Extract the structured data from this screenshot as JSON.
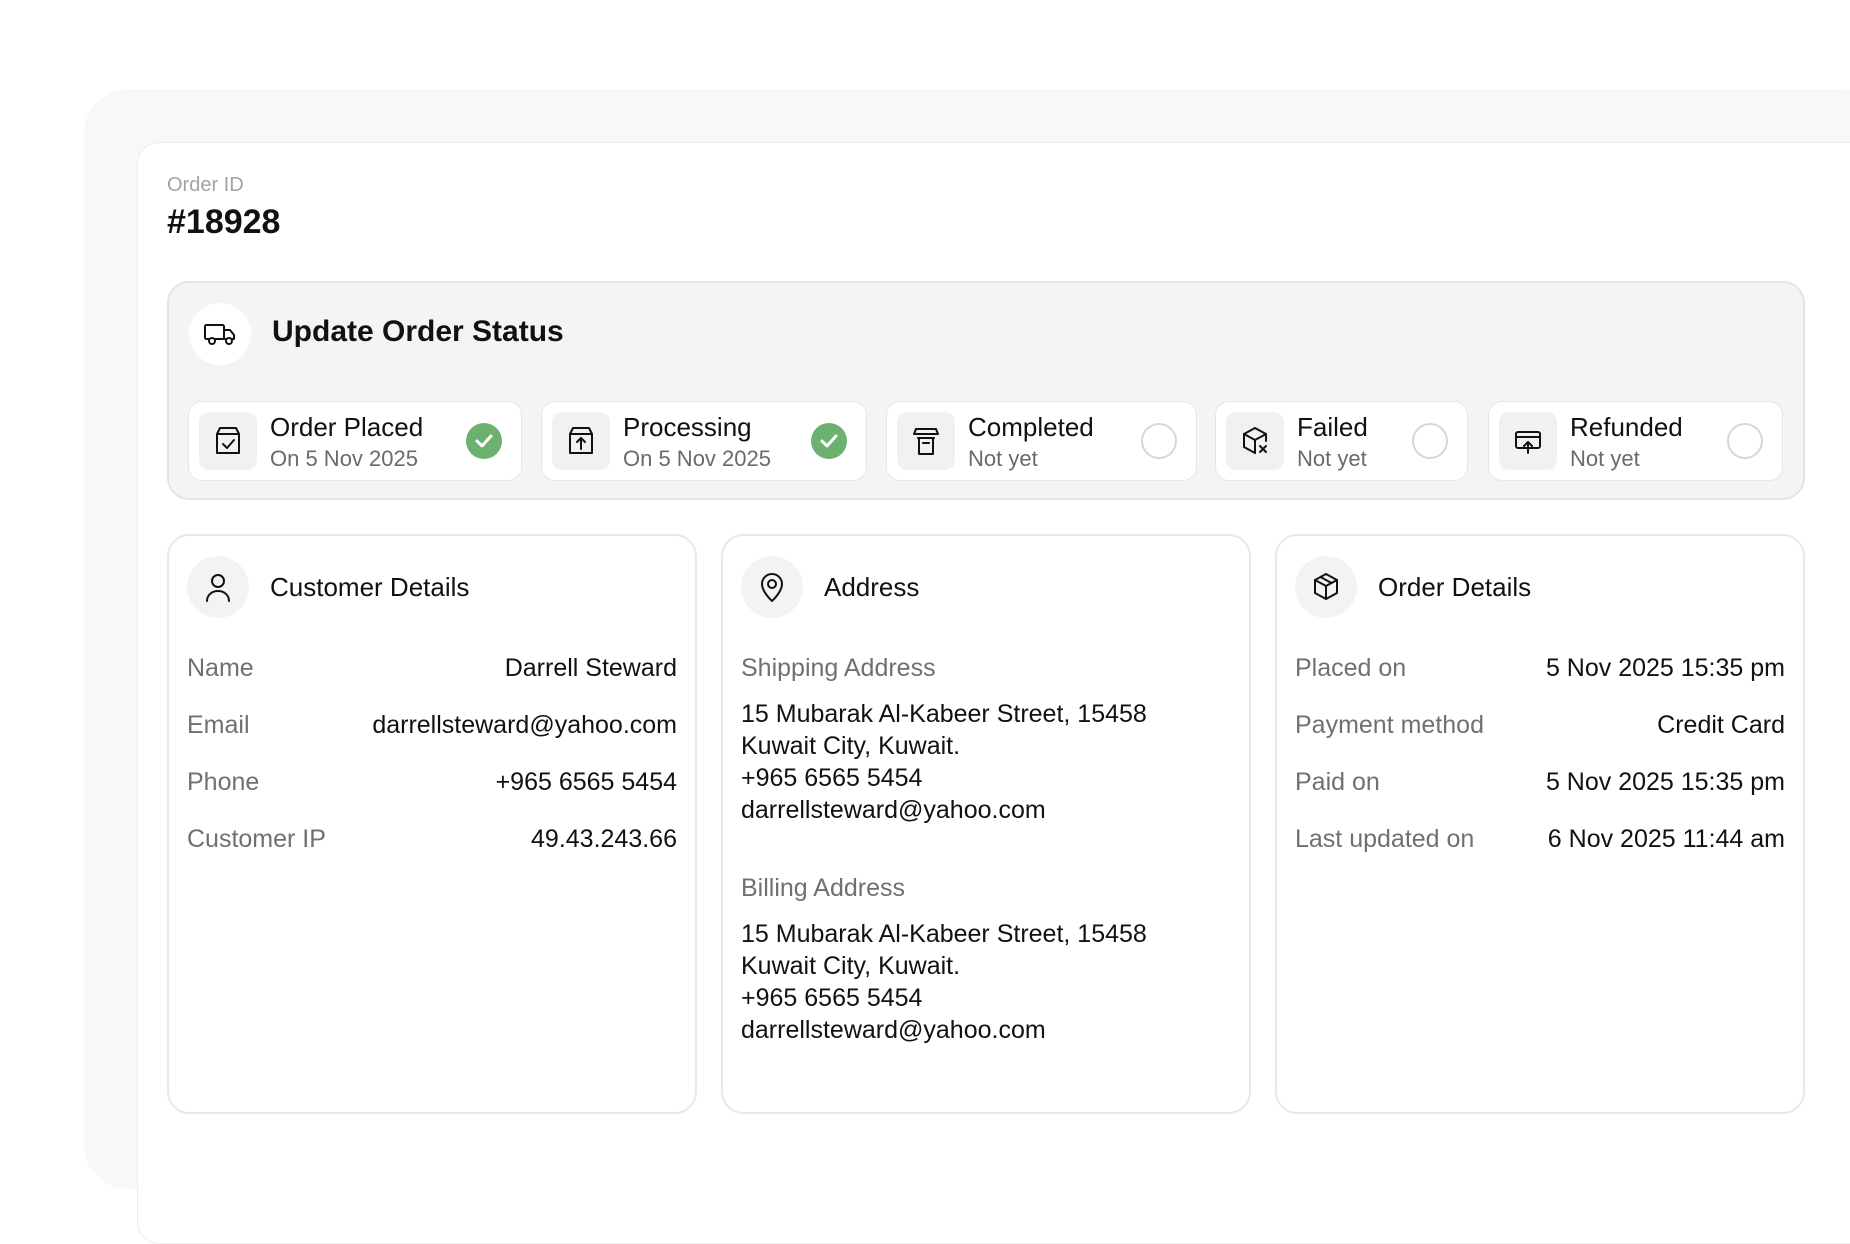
{
  "order": {
    "id_label": "Order ID",
    "id_value": "#18928"
  },
  "status": {
    "title": "Update Order Status",
    "steps": [
      {
        "title": "Order Placed",
        "date": "On 5 Nov 2025",
        "done": true,
        "icon": "cart-check-icon"
      },
      {
        "title": "Processing",
        "date": "On 5 Nov 2025",
        "done": true,
        "icon": "box-upload-icon"
      },
      {
        "title": "Completed",
        "date": "Not yet",
        "done": false,
        "icon": "delivery-box-icon"
      },
      {
        "title": "Failed",
        "date": "Not yet",
        "done": false,
        "icon": "package-x-icon"
      },
      {
        "title": "Refunded",
        "date": "Not yet",
        "done": false,
        "icon": "refund-tray-icon"
      }
    ],
    "colors": {
      "done": "#6db170",
      "pending_border": "#d7d7d7"
    }
  },
  "customer": {
    "title": "Customer Details",
    "rows": [
      {
        "label": "Name",
        "value": "Darrell Steward"
      },
      {
        "label": "Email",
        "value": "darrellsteward@yahoo.com"
      },
      {
        "label": "Phone",
        "value": "+965 6565 5454"
      },
      {
        "label": "Customer IP",
        "value": "49.43.243.66"
      }
    ]
  },
  "address": {
    "title": "Address",
    "shipping_label": "Shipping Address",
    "shipping_lines": [
      "15 Mubarak Al-Kabeer Street, 15458",
      "Kuwait City, Kuwait.",
      "+965 6565 5454",
      "darrellsteward@yahoo.com"
    ],
    "billing_label": "Billing Address",
    "billing_lines": [
      "15 Mubarak Al-Kabeer Street, 15458",
      "Kuwait City, Kuwait.",
      "+965 6565 5454",
      "darrellsteward@yahoo.com"
    ]
  },
  "order_details": {
    "title": "Order Details",
    "rows": [
      {
        "label": "Placed on",
        "value": "5 Nov 2025 15:35 pm"
      },
      {
        "label": "Payment method",
        "value": "Credit Card"
      },
      {
        "label": "Paid on",
        "value": "5 Nov 2025 15:35 pm"
      },
      {
        "label": "Last updated on",
        "value": "6 Nov 2025 11:44 am"
      }
    ]
  }
}
